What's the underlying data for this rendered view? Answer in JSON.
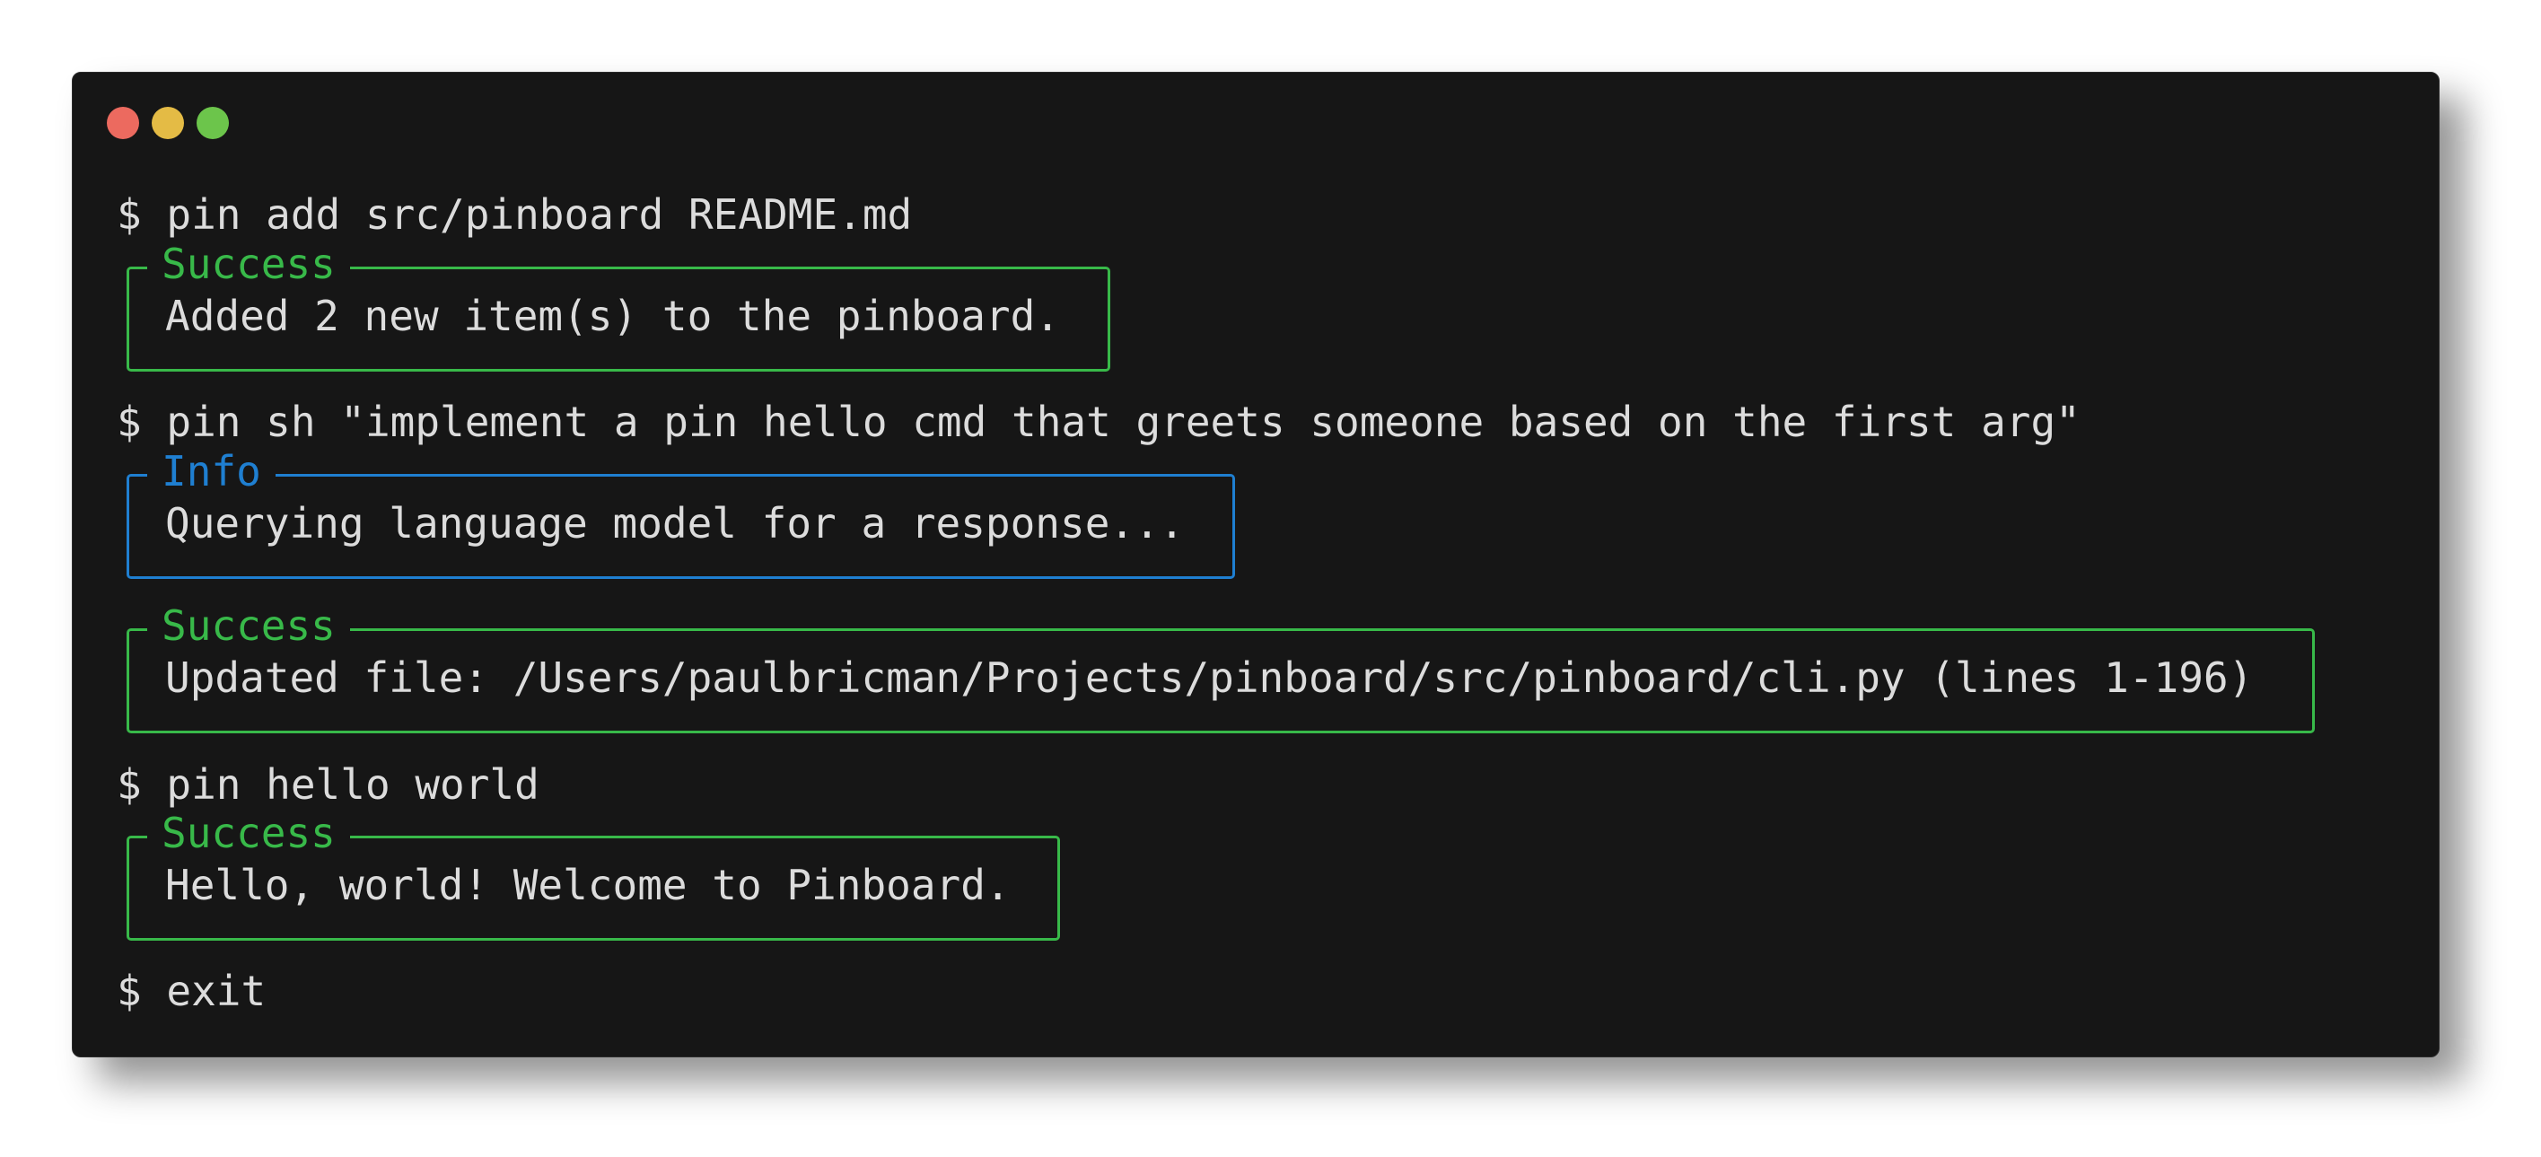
{
  "window": {
    "controls": [
      "close",
      "minimize",
      "zoom"
    ],
    "colors": {
      "background": "#161616",
      "text": "#dcdcdc",
      "success": "#38b949",
      "info": "#1f7fd1",
      "close": "#ec6a5f",
      "minimize": "#e4bb45",
      "zoom": "#6cc54b"
    }
  },
  "session": {
    "cmd1": "$ pin add src/pinboard README.md",
    "panel1": {
      "title": "Success",
      "body": "Added 2 new item(s) to the pinboard."
    },
    "cmd2": "$ pin sh \"implement a pin hello cmd that greets someone based on the first arg\"",
    "panel2": {
      "title": "Info",
      "body": "Querying language model for a response..."
    },
    "panel3": {
      "title": "Success",
      "body": "Updated file: /Users/paulbricman/Projects/pinboard/src/pinboard/cli.py (lines 1-196)"
    },
    "cmd3": "$ pin hello world",
    "panel4": {
      "title": "Success",
      "body": "Hello, world! Welcome to Pinboard."
    },
    "cmd4": "$ exit"
  }
}
